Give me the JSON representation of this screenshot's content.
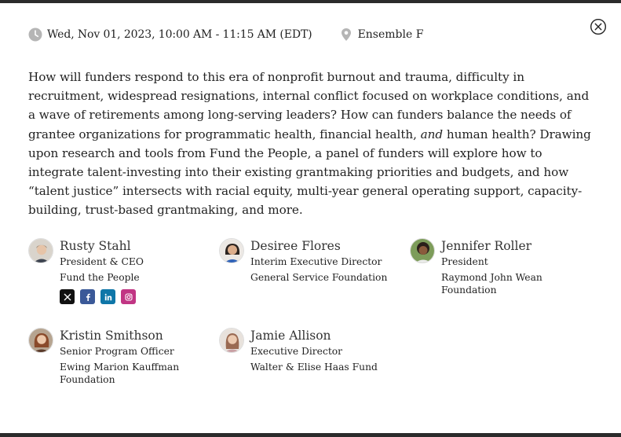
{
  "event": {
    "date_time": "Wed, Nov 01, 2023, 10:00 AM - 11:15 AM (EDT)",
    "location": "Ensemble F"
  },
  "description": {
    "part1": "How will funders respond to this era of nonprofit burnout and trauma, difficulty in recruitment, widespread resignations, internal conflict focused on workplace conditions, and a wave of retirements among long-serving leaders? How can funders balance the needs of grantee organizations for programmatic health, financial health, ",
    "emphasis": "and",
    "part2": " human health? Drawing upon research and tools from Fund the People, a panel of funders will explore how to integrate talent-investing into their existing grantmaking priorities and budgets, and how “talent justice” intersects with racial equity, multi-year general operating support, capacity-building, trust-based grantmaking, and more."
  },
  "speakers": [
    {
      "name": "Rusty Stahl",
      "title": "President & CEO",
      "org": "Fund the People",
      "socials": [
        "x-icon",
        "facebook-icon",
        "linkedin-icon",
        "instagram-icon"
      ]
    },
    {
      "name": "Desiree Flores",
      "title": "Interim Executive Director",
      "org": "General Service Foundation"
    },
    {
      "name": "Jennifer Roller",
      "title": "President",
      "org": "Raymond John Wean Foundation"
    },
    {
      "name": "Kristin Smithson",
      "title": "Senior Program Officer",
      "org": "Ewing Marion Kauffman Foundation"
    },
    {
      "name": "Jamie Allison",
      "title": "Executive Director",
      "org": "Walter & Elise Haas Fund"
    }
  ],
  "icons": {
    "clock": "clock-icon",
    "location": "map-pin-icon",
    "close": "close-circle-icon"
  },
  "colors": {
    "text": "#222222",
    "icon_gray": "#b5b5b5",
    "bar": "#2b2b2b"
  }
}
